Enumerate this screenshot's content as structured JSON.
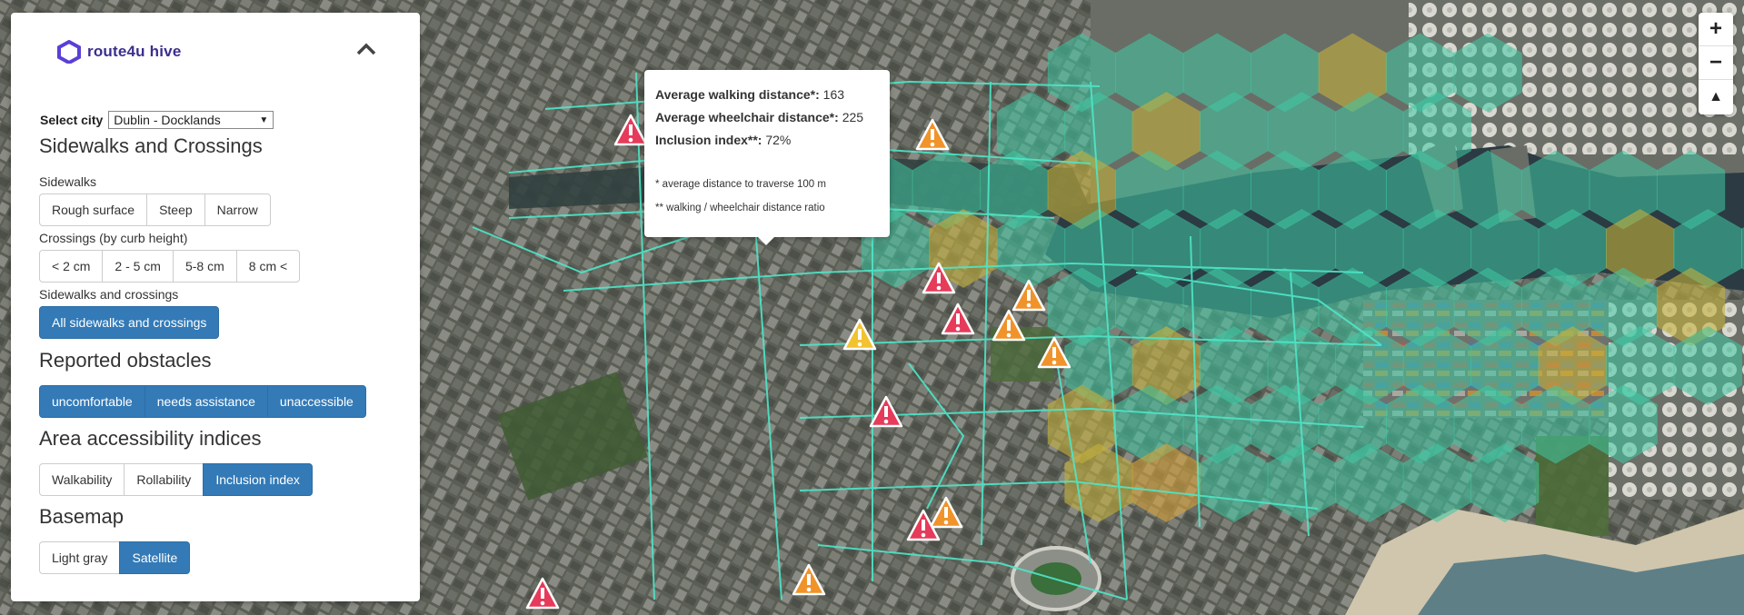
{
  "app": {
    "logo_text": "route4u hive"
  },
  "city": {
    "label": "Select city",
    "value": "Dublin - Docklands"
  },
  "sidewalks_section": {
    "title": "Sidewalks and Crossings",
    "sidewalks_label": "Sidewalks",
    "sidewalks_buttons": [
      "Rough surface",
      "Steep",
      "Narrow"
    ],
    "crossings_label": "Crossings (by curb height)",
    "crossings_buttons": [
      "< 2 cm",
      "2 - 5 cm",
      "5-8 cm",
      "8 cm <"
    ],
    "both_label": "Sidewalks and crossings",
    "both_button": "All sidewalks and crossings"
  },
  "obstacles_section": {
    "title": "Reported obstacles",
    "buttons": [
      "uncomfortable",
      "needs assistance",
      "unaccessible"
    ]
  },
  "indices_section": {
    "title": "Area accessibility indices",
    "buttons": [
      "Walkability",
      "Rollability",
      "Inclusion index"
    ],
    "active": "Inclusion index"
  },
  "basemap_section": {
    "title": "Basemap",
    "buttons": [
      "Light gray",
      "Satellite"
    ],
    "active": "Satellite"
  },
  "popup": {
    "walk_label": "Average walking distance*:",
    "walk_value": "163",
    "wheel_label": "Average wheelchair distance*:",
    "wheel_value": "225",
    "incl_label": "Inclusion index**:",
    "incl_value": "72%",
    "note1": "* average distance to traverse 100 m",
    "note2": "** walking / wheelchair distance ratio"
  },
  "zoom": {
    "in": "+",
    "out": "−",
    "compass": "▲"
  },
  "colors": {
    "hex_green": "#3fc9a4",
    "hex_yellow": "#c4b03c",
    "hex_orange": "#d9a33a",
    "warning_red": "#e63b5a",
    "warning_orange": "#f0932b",
    "warning_yellow": "#f2c230",
    "active_button": "#337ab7"
  }
}
